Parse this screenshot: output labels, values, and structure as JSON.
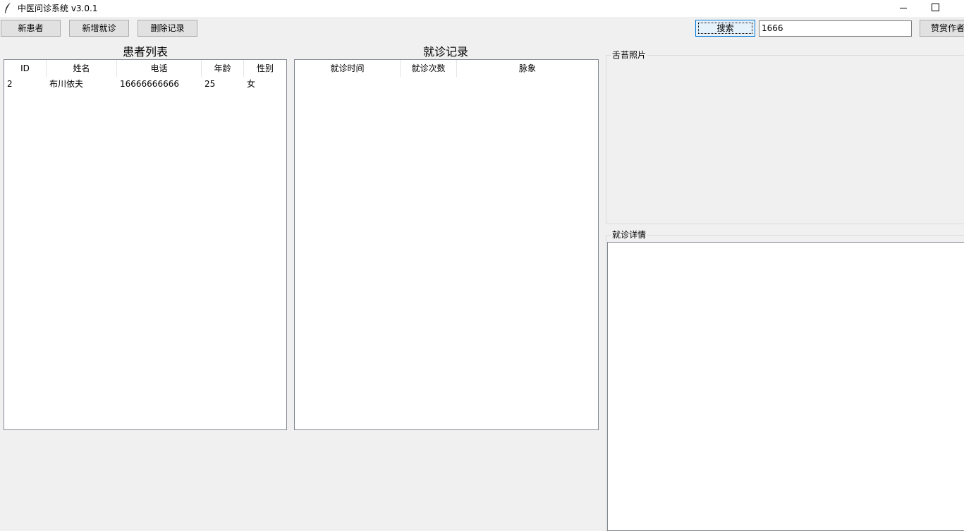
{
  "window": {
    "title": "中医问诊系统 v3.0.1",
    "app_icon": "feather-icon",
    "minimize_icon": "minimize-icon",
    "maximize_icon": "maximize-icon"
  },
  "toolbar": {
    "new_patient_label": "新患者",
    "new_visit_label": "新增就诊",
    "delete_label": "删除记录",
    "search_label": "搜索",
    "search_value": "1666",
    "donate_label": "赞赏作者"
  },
  "patients": {
    "heading": "患者列表",
    "columns": [
      "ID",
      "姓名",
      "电话",
      "年龄",
      "性别"
    ],
    "rows": [
      {
        "id": "2",
        "name": "布川依夫",
        "phone": "16666666666",
        "age": "25",
        "gender": "女"
      }
    ]
  },
  "visits": {
    "heading": "就诊记录",
    "columns": [
      "就诊时间",
      "就诊次数",
      "脉象"
    ],
    "rows": []
  },
  "tongue_photo": {
    "label": "舌苔照片"
  },
  "visit_detail": {
    "label": "就诊详情",
    "text": ""
  },
  "colors": {
    "window_bg": "#f0f0f0",
    "button_bg": "#e1e1e1",
    "focus_border": "#0078d7"
  }
}
